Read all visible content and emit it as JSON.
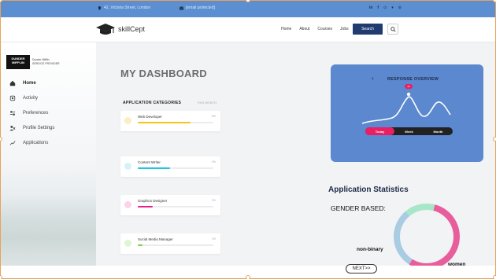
{
  "topbar": {
    "address": "42, Victoria Street, London",
    "email": "[email protected]",
    "socials": [
      "instagram-icon",
      "facebook-icon",
      "pinterest-icon",
      "twitter-icon",
      "youtube-icon"
    ]
  },
  "header": {
    "brand": "skillCept",
    "nav": [
      "Home",
      "About",
      "Courses",
      "Jobs"
    ],
    "search_label": "Search"
  },
  "sidebar": {
    "company_logo": "DUNDER MIFFLIN",
    "company_line1": "Dunder Mifflin",
    "company_line2": "SERVICE PROVIDER",
    "items": [
      {
        "label": "Home",
        "icon": "home-icon",
        "active": true
      },
      {
        "label": "Activity",
        "icon": "activity-icon",
        "active": false
      },
      {
        "label": "Preferences",
        "icon": "preferences-icon",
        "active": false
      },
      {
        "label": "Profile Settings",
        "icon": "profile-settings-icon",
        "active": false
      },
      {
        "label": "Applications",
        "icon": "applications-icon",
        "active": false
      }
    ]
  },
  "main": {
    "title": "MY DASHBOARD",
    "categories_title": "APPLICATION CATEGORIES",
    "categories_period": "THIS MONTH",
    "categories": [
      {
        "name": "Web Developer",
        "count": "8%",
        "progress": 0.7,
        "color": "#f5c518",
        "dot": "#fbeec0"
      },
      {
        "name": "Content Writer",
        "count": "4%",
        "progress": 0.43,
        "color": "#1ec8e0",
        "dot": "#d4f2f8"
      },
      {
        "name": "Graphics Designer",
        "count": "2%",
        "progress": 0.2,
        "color": "#e91e8c",
        "dot": "#fbd3ea"
      },
      {
        "name": "Social Media Manager",
        "count": "1%",
        "progress": 0.06,
        "color": "#7cd04a",
        "dot": "#dff5d3"
      }
    ]
  },
  "response": {
    "title": "RESPONSE OVERVIEW",
    "badge": "20",
    "toggle": [
      "Today",
      "Week",
      "Month"
    ],
    "active_toggle": "Today"
  },
  "stats": {
    "title": "Application Statistics",
    "gender_label": "GENDER BASED:",
    "labels": {
      "nonbinary": "non-binary",
      "women": "women"
    }
  },
  "chart_data": {
    "type": "pie",
    "categories": [
      "women",
      "non-binary",
      "men"
    ],
    "values": [
      55,
      30,
      15
    ],
    "colors": [
      "#e85e9c",
      "#a9cce3",
      "#a8e6c8"
    ]
  },
  "footer": {
    "next_label": "NEXT>>"
  }
}
